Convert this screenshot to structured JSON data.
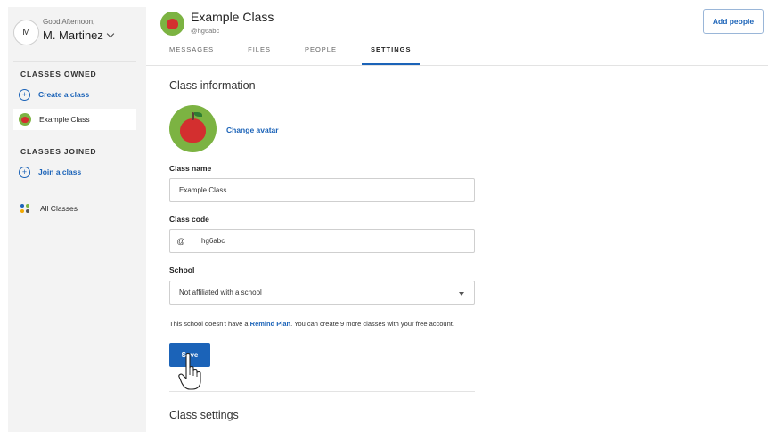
{
  "sidebar": {
    "avatar_initial": "M",
    "greeting": "Good Afternoon,",
    "user_name": "M. Martinez",
    "classes_owned_heading": "CLASSES OWNED",
    "create_class_label": "Create a class",
    "owned_class_label": "Example Class",
    "classes_joined_heading": "CLASSES JOINED",
    "join_class_label": "Join a class",
    "all_classes_label": "All Classes"
  },
  "header": {
    "class_title": "Example Class",
    "class_handle": "@hg6abc",
    "add_people_label": "Add people",
    "tabs": [
      {
        "label": "MESSAGES"
      },
      {
        "label": "FILES"
      },
      {
        "label": "PEOPLE"
      },
      {
        "label": "SETTINGS",
        "active": true
      }
    ]
  },
  "main": {
    "class_information_title": "Class information",
    "change_avatar_label": "Change avatar",
    "class_name_label": "Class name",
    "class_name_value": "Example Class",
    "class_code_label": "Class code",
    "class_code_prefix": "@",
    "class_code_value": "hg6abc",
    "school_label": "School",
    "school_value": "Not affiliated with a school",
    "plan_note_before": "This school doesn't have a ",
    "plan_note_link": "Remind Plan",
    "plan_note_after": ". You can create 9 more classes with your free account.",
    "save_label": "Save",
    "class_settings_title": "Class settings"
  },
  "colors": {
    "accent": "#1b63b8",
    "sidebar_bg": "#f3f3f3",
    "avatar_green": "#7cb342",
    "apple_red": "#d32f2f"
  },
  "icons": {
    "chevron": "chevron-down-icon",
    "create": "plus-circle-icon",
    "join": "plus-circle-icon",
    "all_classes": "dots-grid-icon",
    "cursor": "hand-pointer-icon",
    "school_dropdown": "caret-down-icon"
  }
}
